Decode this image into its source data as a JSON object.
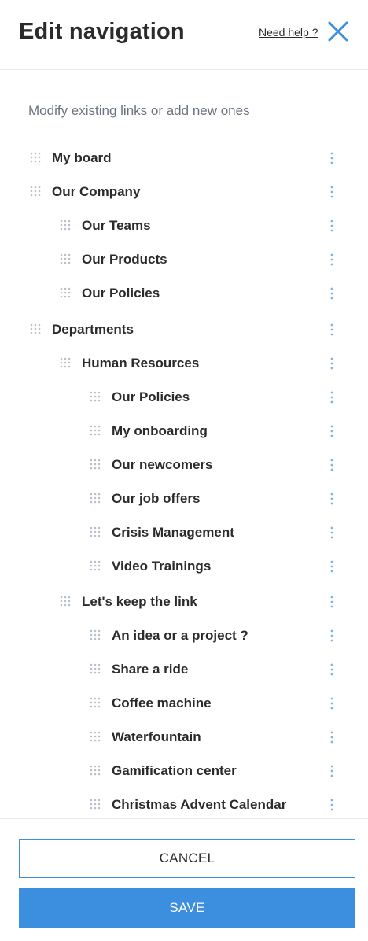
{
  "header": {
    "title": "Edit navigation",
    "help_label": "Need help ?"
  },
  "subtitle": "Modify existing links or add new ones",
  "nav_items": [
    {
      "label": "My board",
      "level": 0
    },
    {
      "label": "Our Company",
      "level": 0
    },
    {
      "label": "Our Teams",
      "level": 1
    },
    {
      "label": "Our Products",
      "level": 1
    },
    {
      "label": "Our Policies",
      "level": 1
    },
    {
      "label": "Departments",
      "level": 0
    },
    {
      "label": "Human Resources",
      "level": 1
    },
    {
      "label": "Our Policies",
      "level": 2
    },
    {
      "label": "My onboarding",
      "level": 2
    },
    {
      "label": "Our newcomers",
      "level": 2
    },
    {
      "label": "Our job offers",
      "level": 2
    },
    {
      "label": "Crisis Management",
      "level": 2
    },
    {
      "label": "Video Trainings",
      "level": 2
    },
    {
      "label": "Let's keep the link",
      "level": 1
    },
    {
      "label": "An idea or a project ?",
      "level": 2
    },
    {
      "label": "Share a ride",
      "level": 2
    },
    {
      "label": "Coffee machine",
      "level": 2
    },
    {
      "label": "Waterfountain",
      "level": 2
    },
    {
      "label": "Gamification center",
      "level": 2
    },
    {
      "label": "Christmas Advent Calendar",
      "level": 2
    }
  ],
  "footer": {
    "cancel_label": "CANCEL",
    "save_label": "SAVE"
  },
  "colors": {
    "accent": "#3b8fde",
    "text": "#2b2b2b",
    "muted": "#6b7280"
  },
  "icons": {
    "close": "close-icon",
    "drag": "drag-handle-icon",
    "more": "more-vertical-icon"
  }
}
